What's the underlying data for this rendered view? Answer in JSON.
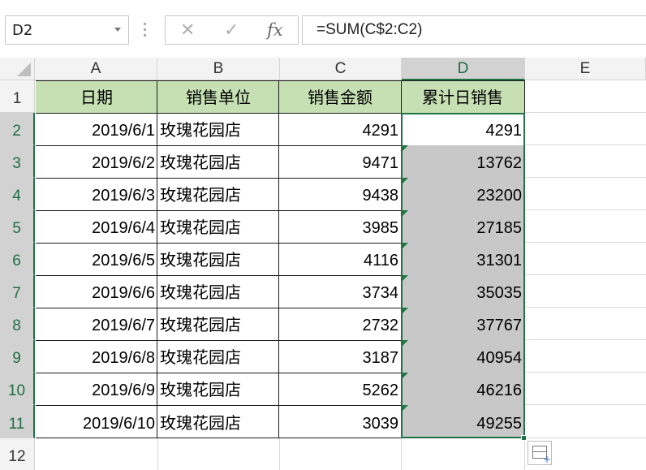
{
  "name_box": {
    "value": "D2"
  },
  "formula_bar": {
    "cancel_icon": "cancel-icon",
    "enter_icon": "enter-icon",
    "fx_label": "fx",
    "formula": "=SUM(C$2:C2)"
  },
  "columns": [
    "A",
    "B",
    "C",
    "D",
    "E"
  ],
  "rows": [
    "1",
    "2",
    "3",
    "4",
    "5",
    "6",
    "7",
    "8",
    "9",
    "10",
    "11",
    "12"
  ],
  "table": {
    "headers": [
      "日期",
      "销售单位",
      "销售金额",
      "累计日销售"
    ],
    "rows": [
      [
        "2019/6/1",
        "玫瑰花园店",
        "4291",
        "4291"
      ],
      [
        "2019/6/2",
        "玫瑰花园店",
        "9471",
        "13762"
      ],
      [
        "2019/6/3",
        "玫瑰花园店",
        "9438",
        "23200"
      ],
      [
        "2019/6/4",
        "玫瑰花园店",
        "3985",
        "27185"
      ],
      [
        "2019/6/5",
        "玫瑰花园店",
        "4116",
        "31301"
      ],
      [
        "2019/6/6",
        "玫瑰花园店",
        "3734",
        "35035"
      ],
      [
        "2019/6/7",
        "玫瑰花园店",
        "2732",
        "37767"
      ],
      [
        "2019/6/8",
        "玫瑰花园店",
        "3187",
        "40954"
      ],
      [
        "2019/6/9",
        "玫瑰花园店",
        "5262",
        "46216"
      ],
      [
        "2019/6/10",
        "玫瑰花园店",
        "3039",
        "49255"
      ]
    ]
  },
  "selection": {
    "active_cell": "D2",
    "range": "D2:D11"
  },
  "colors": {
    "header_fill": "#c6e0b4",
    "selected_fill": "#c8c8c8",
    "accent": "#217346"
  }
}
